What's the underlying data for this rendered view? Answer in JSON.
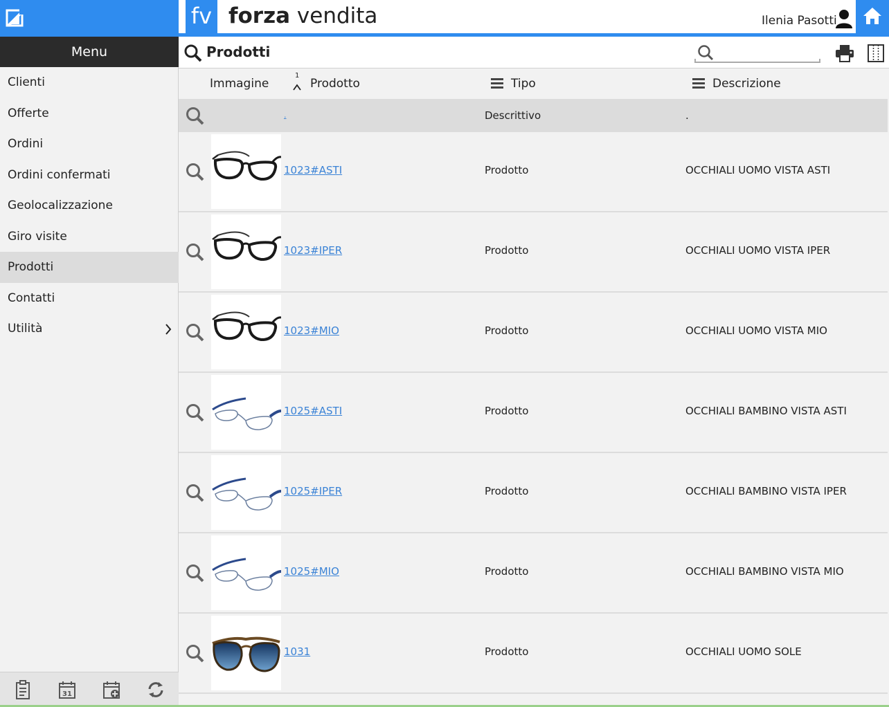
{
  "app": {
    "logo_short": "fv",
    "brand_bold": "forza",
    "brand_light": " vendita",
    "user_name": "Ilenia Pasotti"
  },
  "sidebar": {
    "menu_label": "Menu",
    "items": [
      {
        "label": "Clienti"
      },
      {
        "label": "Offerte"
      },
      {
        "label": "Ordini"
      },
      {
        "label": "Ordini confermati"
      },
      {
        "label": "Geolocalizzazione"
      },
      {
        "label": "Giro visite"
      },
      {
        "label": "Prodotti",
        "active": true
      },
      {
        "label": "Contatti"
      },
      {
        "label": "Utilità",
        "has_submenu": true
      }
    ],
    "footer_icons": [
      "clipboard-icon",
      "calendar-31-icon",
      "calendar-add-icon",
      "sync-icon"
    ]
  },
  "page": {
    "title": "Prodotti",
    "search_placeholder": ""
  },
  "table": {
    "columns": {
      "image": "Immagine",
      "product": "Prodotto",
      "product_sort_index": "1",
      "type": "Tipo",
      "description": "Descrizione"
    },
    "filter": {
      "product": ".",
      "type": "Descrittivo",
      "description": "."
    },
    "rows": [
      {
        "code": "1023#ASTI",
        "type": "Prodotto",
        "description": "OCCHIALI UOMO VISTA ASTI",
        "image": "black-frame-glasses"
      },
      {
        "code": "1023#IPER",
        "type": "Prodotto",
        "description": "OCCHIALI UOMO VISTA IPER",
        "image": "black-frame-glasses"
      },
      {
        "code": "1023#MIO",
        "type": "Prodotto",
        "description": "OCCHIALI UOMO VISTA MIO",
        "image": "black-frame-glasses"
      },
      {
        "code": "1025#ASTI",
        "type": "Prodotto",
        "description": "OCCHIALI BAMBINO VISTA ASTI",
        "image": "blue-wire-glasses"
      },
      {
        "code": "1025#IPER",
        "type": "Prodotto",
        "description": "OCCHIALI BAMBINO VISTA IPER",
        "image": "blue-wire-glasses"
      },
      {
        "code": "1025#MIO",
        "type": "Prodotto",
        "description": "OCCHIALI BAMBINO VISTA MIO",
        "image": "blue-wire-glasses"
      },
      {
        "code": "1031",
        "type": "Prodotto",
        "description": "OCCHIALI UOMO SOLE",
        "image": "aviator-sunglasses"
      }
    ]
  },
  "colors": {
    "accent": "#2f8cef",
    "menu_header": "#2b2b2b",
    "link": "#3b83d6",
    "active_item": "#dcdcdc"
  }
}
